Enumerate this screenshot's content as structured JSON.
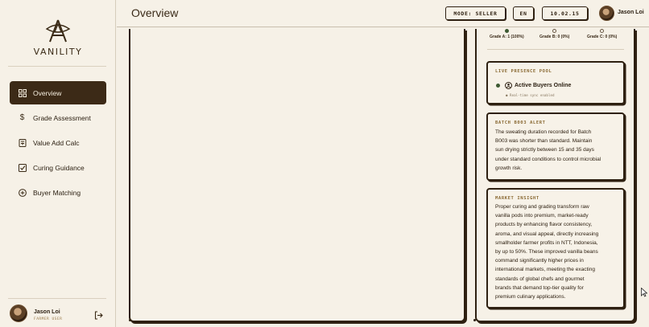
{
  "brand": {
    "name": "VANILITY"
  },
  "sidebar": {
    "items": [
      {
        "label": "Overview",
        "icon": "grid-icon",
        "active": true
      },
      {
        "label": "Grade Assessment",
        "icon": "dollar-icon",
        "active": false
      },
      {
        "label": "Value Add Calc",
        "icon": "calculator-icon",
        "active": false
      },
      {
        "label": "Curing Guidance",
        "icon": "checkbox-icon",
        "active": false
      },
      {
        "label": "Buyer Matching",
        "icon": "plus-circle-icon",
        "active": false
      }
    ],
    "user": {
      "name": "Jason Loi",
      "role": "FARMER USER"
    }
  },
  "header": {
    "title": "Overview",
    "mode": "MODE: SELLER",
    "language": "EN",
    "date": "10.02.15",
    "user_name": "Jason Loi"
  },
  "grades": [
    {
      "label": "Grade A: 1 (100%)",
      "filled": true
    },
    {
      "label": "Grade B: 0 (0%)",
      "filled": false
    },
    {
      "label": "Grade C: 0 (0%)",
      "filled": false
    }
  ],
  "presence": {
    "title": "LIVE PRESENCE POOL",
    "label": "Active Buyers Online",
    "sync": "● Real-time sync enabled"
  },
  "alert": {
    "title": "BATCH B003 ALERT",
    "lines": [
      "The sweating duration recorded for Batch",
      "B003 was shorter than standard. Maintain",
      "sun drying strictly between 15 and 35 days",
      "under standard conditions to control microbial",
      "growth risk."
    ]
  },
  "insight": {
    "title": "MARKET INSIGHT",
    "lines": [
      "Proper curing and grading transform raw",
      "vanilla pods into premium, market-ready",
      "products by enhancing flavor consistency,",
      "aroma, and visual appeal, directly increasing",
      "smallholder farmer profits in NTT, Indonesia,",
      "by up to 50%. These improved vanilla beans",
      "command significantly higher prices in",
      "international markets, meeting the exacting",
      "standards of global chefs and gourmet",
      "brands that demand top-tier quality for",
      "premium culinary applications."
    ]
  },
  "colors": {
    "accent": "#3c2a17",
    "background": "#f5f0e6",
    "status_green": "#3d5a32",
    "label_gold": "#8a6a34"
  }
}
